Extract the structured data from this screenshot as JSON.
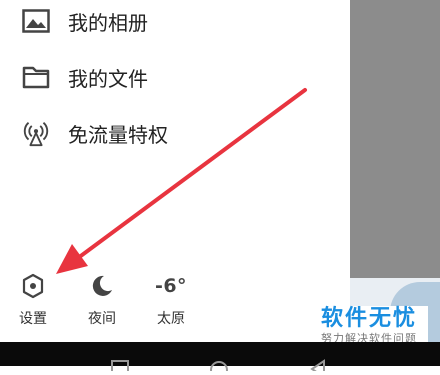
{
  "menu": {
    "items": [
      {
        "label": "我的相册",
        "icon": "image-icon"
      },
      {
        "label": "我的文件",
        "icon": "folder-icon"
      },
      {
        "label": "免流量特权",
        "icon": "broadcast-icon"
      }
    ]
  },
  "bottom_bar": {
    "settings_label": "设置",
    "night_label": "夜间",
    "weather_temp": "-6°",
    "weather_city": "太原"
  },
  "watermark": {
    "main": "软件无忧",
    "sub": "努力解决软件问题"
  },
  "colors": {
    "arrow": "#e8343f",
    "overlay": "#8c8c8c",
    "watermark_blue": "#1a8ee0"
  }
}
